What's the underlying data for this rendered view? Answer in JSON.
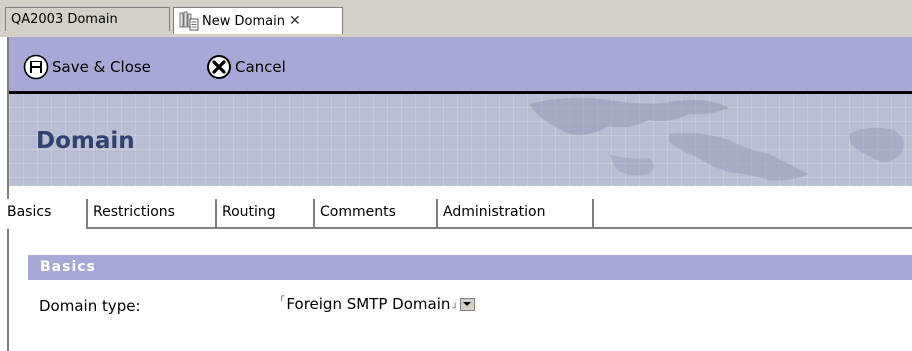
{
  "doc_tabs": [
    {
      "label": "QA2003 Domain",
      "active": false
    },
    {
      "label": "New Domain",
      "active": true
    }
  ],
  "toolbar": {
    "save_close_label": "Save & Close",
    "cancel_label": "Cancel",
    "background": "#a8a8d6"
  },
  "banner": {
    "title": "Domain"
  },
  "section_tabs": [
    {
      "label": "Basics"
    },
    {
      "label": "Restrictions"
    },
    {
      "label": "Routing"
    },
    {
      "label": "Comments"
    },
    {
      "label": "Administration"
    }
  ],
  "basics": {
    "header": "Basics",
    "domain_type": {
      "label": "Domain type:",
      "value": "Foreign SMTP Domain"
    }
  }
}
